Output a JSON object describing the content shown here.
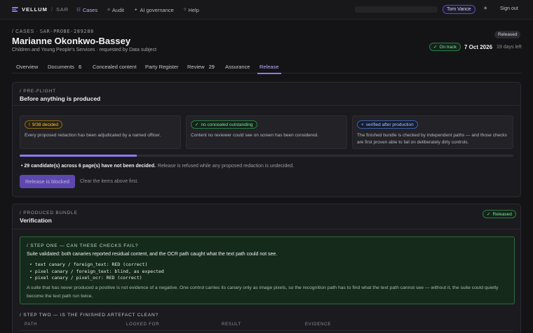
{
  "nav": {
    "brand": "VELLUM",
    "brand_sep": "/",
    "brand_sub": "SAR",
    "links": [
      {
        "icon": "☷",
        "label": "Cases",
        "active": true
      },
      {
        "icon": "≡",
        "label": "Audit"
      },
      {
        "icon": "✦",
        "label": "AI governance"
      },
      {
        "icon": "?",
        "label": "Help"
      }
    ],
    "user": "Tom Vance",
    "theme_icon": "☀",
    "sign_out": "Sign out"
  },
  "case": {
    "crumb_prefix": "/ CASES ·",
    "crumb_id": "SAR-PROBE-289288",
    "title": "Marianne Okonkwo-Bassey",
    "subtitle": "Children and Young People's Services · requested by Data subject",
    "status": "Released",
    "on_track": "On track",
    "on_track_icon": "✓",
    "due_date": "7 Oct 2026",
    "days_left": "19 days left"
  },
  "tabs": [
    {
      "label": "Overview"
    },
    {
      "label": "Documents",
      "count": "6"
    },
    {
      "label": "Concealed content"
    },
    {
      "label": "Party Register"
    },
    {
      "label": "Review",
      "count": "29"
    },
    {
      "label": "Assurance"
    },
    {
      "label": "Release",
      "active": true
    }
  ],
  "preflight": {
    "kicker": "/ PRE-FLIGHT",
    "title": "Before anything is produced",
    "cards": [
      {
        "badge_icon": "!",
        "badge": "9/38 decided",
        "text": "Every proposed redaction has been adjudicated by a named officer."
      },
      {
        "badge_icon": "✓",
        "badge": "no concealed outstanding",
        "text": "Content no reviewer could see on screen has been considered."
      },
      {
        "badge_icon": "+",
        "badge": "verified after production",
        "text": "The finished bundle is checked by independent paths — and those checks are first proven able to fail on deliberately dirty controls."
      }
    ],
    "progress_fraction": 0.237,
    "blocked_bold": "29 candidate(s) across 6 page(s) have not been decided.",
    "blocked_rest": "Release is refused while any proposed redaction is undecided.",
    "button": "Release is blocked",
    "hint": "Clear the items above first."
  },
  "bundle": {
    "kicker": "/ PRODUCED BUNDLE",
    "title": "Verification",
    "badge_icon": "✓",
    "badge": "Released",
    "step1": {
      "kicker": "/ STEP ONE — CAN THESE CHECKS FAIL?",
      "summary": "Suite validated: both canaries reported residual content, and the OCR path caught what the text path could not see.",
      "items": [
        "text canary / foreign_text: RED (correct)",
        "pixel canary / foreign_text: blind, as expected",
        "pixel canary / pixel_ocr: RED (correct)"
      ],
      "note": "A suite that has never produced a positive is not evidence of a negative. One control carries its canary only as image pixels, so the recognition path has to find what the text path cannot see — without it, the suite could quietly become the text path run twice."
    },
    "step2": {
      "kicker": "/ STEP TWO — IS THE FINISHED ARTEFACT CLEAN?",
      "columns": [
        "PATH",
        "LOOKED FOR",
        "RESULT",
        "EVIDENCE"
      ]
    }
  }
}
